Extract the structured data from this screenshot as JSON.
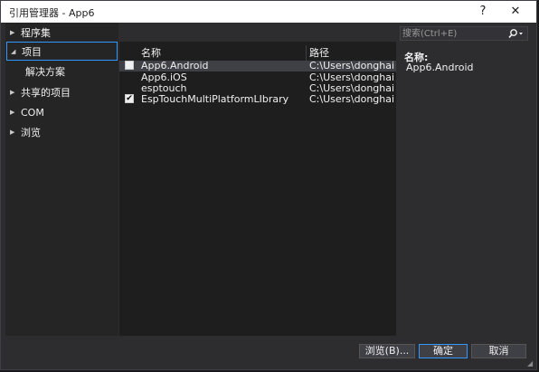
{
  "window": {
    "title": "引用管理器 - App6"
  },
  "titlebar": {
    "help_label": "?",
    "close_label": "✕"
  },
  "tree": {
    "items": [
      {
        "label": "程序集",
        "arrow": "▶"
      },
      {
        "label": "项目",
        "arrow": "◢"
      },
      {
        "label": "解决方案"
      },
      {
        "label": "共享的项目",
        "arrow": "▶"
      },
      {
        "label": "COM",
        "arrow": "▶"
      },
      {
        "label": "浏览",
        "arrow": "▶"
      }
    ]
  },
  "list": {
    "columns": {
      "name": "名称",
      "path": "路径"
    },
    "rows": [
      {
        "checked": false,
        "name": "App6.Android",
        "path": "C:\\Users\\donghai\\s..."
      },
      {
        "checked": false,
        "name": "App6.iOS",
        "path": "C:\\Users\\donghai\\s..."
      },
      {
        "checked": false,
        "name": "esptouch",
        "path": "C:\\Users\\donghai\\s..."
      },
      {
        "checked": true,
        "name": "EspTouchMultiPlatformLIbrary",
        "path": "C:\\Users\\donghai\\s..."
      }
    ]
  },
  "search": {
    "placeholder": "搜索(Ctrl+E)",
    "icon": "search-icon"
  },
  "details": {
    "name_label": "名称:",
    "name_value": "App6.Android"
  },
  "footer": {
    "browse_label": "浏览(B)...",
    "ok_label": "确定",
    "cancel_label": "取消"
  },
  "colors": {
    "accent": "#3399ff",
    "background": "#2d2d30",
    "list_bg": "#1e1e1e"
  }
}
